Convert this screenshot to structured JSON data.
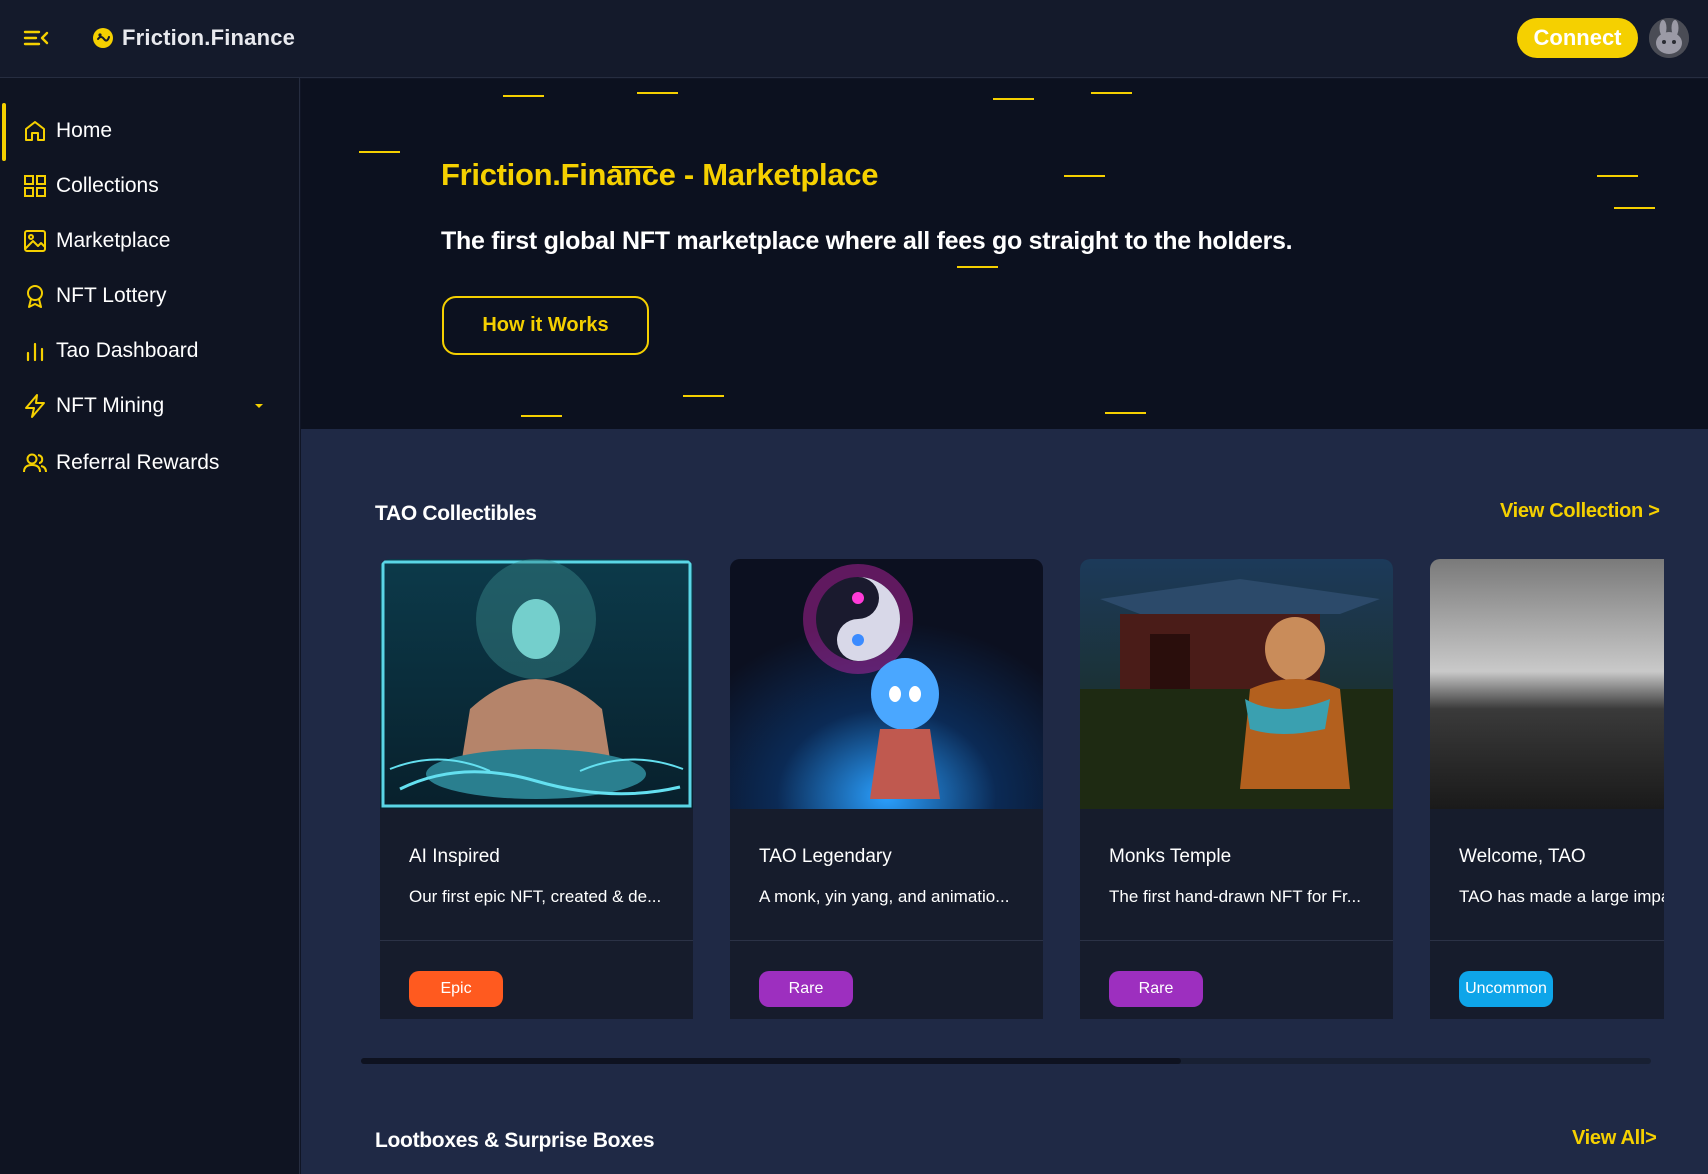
{
  "header": {
    "brand_name": "Friction.Finance",
    "connect_label": "Connect"
  },
  "sidebar": {
    "items": [
      {
        "label": "Home",
        "icon": "home-icon",
        "active": true
      },
      {
        "label": "Collections",
        "icon": "grid-icon"
      },
      {
        "label": "Marketplace",
        "icon": "image-icon"
      },
      {
        "label": "NFT Lottery",
        "icon": "award-icon"
      },
      {
        "label": "Tao Dashboard",
        "icon": "bar-chart-icon"
      },
      {
        "label": "NFT Mining",
        "icon": "lightning-icon",
        "expandable": true
      },
      {
        "label": "Referral Rewards",
        "icon": "users-icon"
      }
    ]
  },
  "hero": {
    "title": "Friction.Finance - Marketplace",
    "subtitle": "The first global NFT marketplace where all fees go straight to the holders.",
    "cta_label": "How it Works"
  },
  "collectibles": {
    "title": "TAO Collectibles",
    "link_label": "View Collection >",
    "cards": [
      {
        "name": "AI Inspired",
        "description": "Our first epic NFT, created & de...",
        "rarity": "Epic"
      },
      {
        "name": "TAO Legendary",
        "description": "A monk, yin yang, and animatio...",
        "rarity": "Rare"
      },
      {
        "name": "Monks Temple",
        "description": "The first hand-drawn NFT for Fr...",
        "rarity": "Rare"
      },
      {
        "name": "Welcome, TAO",
        "description": "TAO has made a large impa",
        "rarity": "Uncommon"
      }
    ]
  },
  "lootboxes": {
    "title": "Lootboxes & Surprise Boxes",
    "link_label": "View All>"
  },
  "colors": {
    "accent": "#f5d000",
    "epic": "#ff5a1f",
    "rare": "#9d2fbf",
    "uncommon": "#0ea5e9"
  }
}
